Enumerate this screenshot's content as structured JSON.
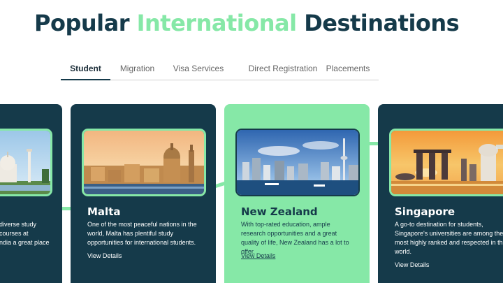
{
  "heading": {
    "part1": "Popular ",
    "part2": "International",
    "part3": " Destinations"
  },
  "tabs": [
    "Student",
    "Migration",
    "Visa Services",
    "Direct Registration",
    "Placements"
  ],
  "active_tab": "Student",
  "cards": {
    "partial": {
      "lines": [
        "diverse study",
        "courses at",
        "ndia a great place"
      ]
    },
    "malta": {
      "title": "Malta",
      "description": "One of the most peaceful nations in the world, Malta has plentiful study opportunities for international students.",
      "link": "View Details"
    },
    "new_zealand": {
      "title": "New Zealand",
      "description": "With top-rated education, ample research opportunities and a great quality of life, New Zealand has a lot to offer.",
      "link": "View Details"
    },
    "singapore": {
      "title": "Singapore",
      "description": "A go-to destination for students, Singapore's universities are among the most highly ranked and respected in the world.",
      "link": "View Details"
    }
  },
  "colors": {
    "navy": "#153a4a",
    "mint": "#86e8a7",
    "tab_text": "#666666"
  },
  "images": [
    "taj-mahal-photo",
    "malta-city-photo",
    "auckland-skyline-photo",
    "singapore-marina-photo"
  ]
}
